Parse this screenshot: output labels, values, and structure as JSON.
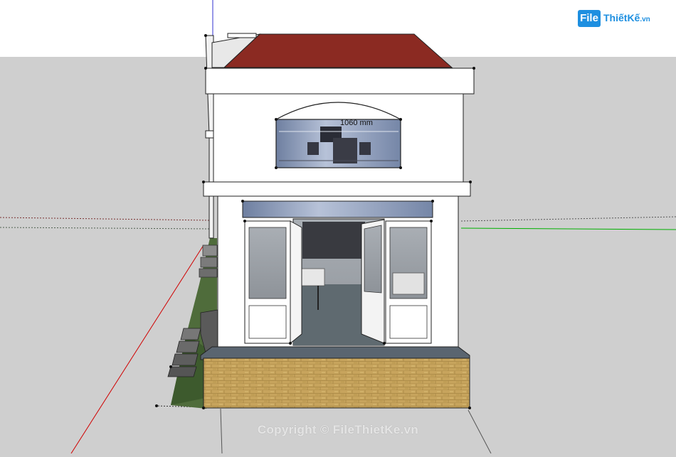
{
  "watermark": {
    "logo_box": "File",
    "logo_text": "ThiếtKế",
    "logo_domain": ".vn",
    "copyright": "Copyright © FileThietKe.vn"
  },
  "model": {
    "dimension_label": "1060 mm"
  },
  "colors": {
    "sky": "#ffffff",
    "ground": "#cfcfcf",
    "roof": "#8b2a22",
    "wall": "#ffffff",
    "brick": "#c6a35a",
    "grass": "#4e6b3a",
    "axis_green": "#00b000",
    "axis_red": "#d00000",
    "axis_blue": "#3030d0",
    "glass": "#8f9eb8",
    "floor": "#5f6a70"
  }
}
